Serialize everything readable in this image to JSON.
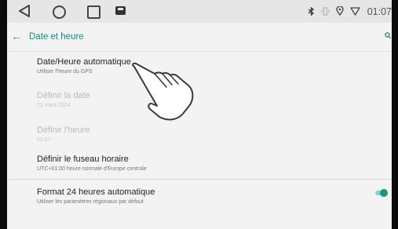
{
  "statusbar": {
    "time": "01:07",
    "nav": [
      "back",
      "home",
      "recents",
      "screenshot"
    ],
    "icons": [
      "bluetooth-icon",
      "vibrate-icon",
      "location-icon",
      "wifi-icon"
    ]
  },
  "toolbar": {
    "title": "Date et heure",
    "accent": "#0f8f78"
  },
  "settings": [
    {
      "title": "Date/Heure automatique",
      "subtitle": "Utiliser l'heure du GPS",
      "enabled": true
    },
    {
      "title": "Définir la date",
      "subtitle": "21 mars 2024",
      "enabled": false
    },
    {
      "title": "Définir l'heure",
      "subtitle": "01:07",
      "enabled": false
    },
    {
      "title": "Définir le fuseau horaire",
      "subtitle": "UTC+01:00 heure normale d'Europe centrale",
      "enabled": true
    },
    {
      "title": "Format 24 heures automatique",
      "subtitle": "Utiliser les paramètres régionaux par défaut",
      "enabled": true,
      "toggle_on": true
    }
  ]
}
